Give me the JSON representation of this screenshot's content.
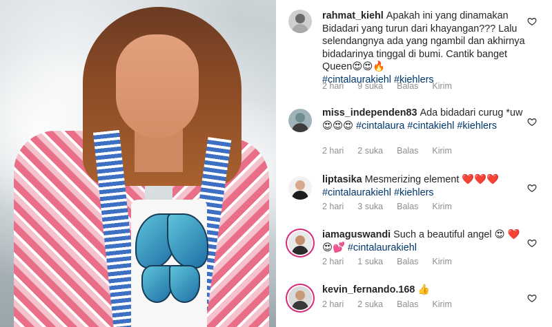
{
  "comments": [
    {
      "username": "rahmat_kiehl",
      "text": "Apakah ini yang dinamakan Bidadari yang turun dari khayangan??? Lalu selendangnya ada yang ngambil dan akhirnya bidadarinya tinggal di bumi. Cantik banget Queen😍😍🔥",
      "tags": [
        "#cintalaurakiehl",
        "#kiehlers"
      ],
      "time": "2 hari",
      "likes": "9 suka",
      "reply": "Balas",
      "send": "Kirim",
      "story_ring": false,
      "avatar_colors": [
        "#cfcfcf",
        "#a9a9a9",
        "#6a6a6a"
      ]
    },
    {
      "username": "miss_independen83",
      "text": "Ada bidadari curug *uw 😍😍😍",
      "tags": [
        "#cintalaura",
        "#cintakiehl",
        "#kiehlers"
      ],
      "time": "2 hari",
      "likes": "2 suka",
      "reply": "Balas",
      "send": "Kirim",
      "story_ring": false,
      "avatar_colors": [
        "#9fb4b8",
        "#3d3d3d",
        "#6f8b8f"
      ]
    },
    {
      "username": "liptasika",
      "text": "Mesmerizing element ❤️❤️❤️",
      "tags": [
        "#cintalaurakiehl",
        "#kiehlers"
      ],
      "time": "2 hari",
      "likes": "3 suka",
      "reply": "Balas",
      "send": "Kirim",
      "story_ring": false,
      "avatar_colors": [
        "#f2f2f2",
        "#1d1d1d",
        "#d9a98b"
      ]
    },
    {
      "username": "iamaguswandi",
      "text": "Such a beautiful angel 😍 ❤️😍💕",
      "tags": [
        "#cintalaurakiehl"
      ],
      "time": "2 hari",
      "likes": "1 suka",
      "reply": "Balas",
      "send": "Kirim",
      "story_ring": true,
      "avatar_colors": [
        "#e9e9e9",
        "#2b2b2b",
        "#c58f6d"
      ]
    },
    {
      "username": "kevin_fernando.168",
      "text": "👍",
      "tags": [],
      "time": "2 hari",
      "likes": "2 suka",
      "reply": "Balas",
      "send": "Kirim",
      "story_ring": true,
      "avatar_colors": [
        "#dadada",
        "#3a3a3a",
        "#c99a7a"
      ]
    }
  ],
  "icons": {
    "like": "heart-outline-icon"
  },
  "colors": {
    "username": "#262626",
    "hashtag": "#00376b",
    "meta": "#8e8e8e",
    "story_ring": "#d62976"
  }
}
